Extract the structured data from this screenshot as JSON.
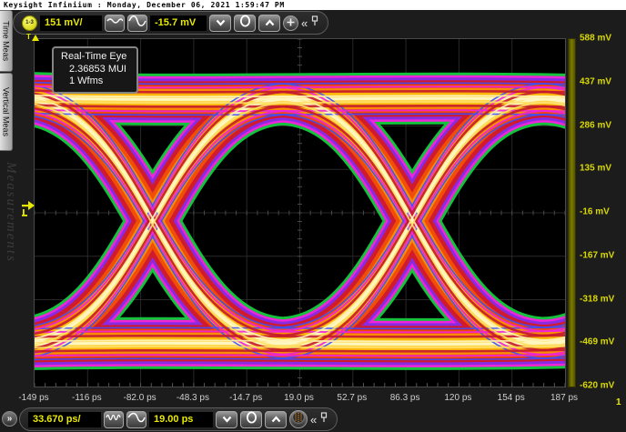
{
  "title_bar": {
    "text": "Keysight Infiniium : Monday, December 06, 2021 1:59:47 PM"
  },
  "sidebar": {
    "tabs": [
      {
        "label": "Time Meas"
      },
      {
        "label": "Vertical Meas"
      }
    ],
    "watermark": "Measurements"
  },
  "channel_toolbar": {
    "badge": "1-3",
    "scale": "151 mV/",
    "offset": "-15.7 mV"
  },
  "timebase_toolbar": {
    "scale": "33.670 ps/",
    "position": "19.00 ps"
  },
  "eye_overlay": {
    "title": "Real-Time Eye",
    "mui": "2.36853 MUI",
    "wfms": "1 Wfms"
  },
  "plot": {
    "trigger_marker": "T",
    "channel_indicator": "1",
    "y_ticks": [
      "588 mV",
      "437 mV",
      "286 mV",
      "135 mV",
      "-16 mV",
      "-167 mV",
      "-318 mV",
      "-469 mV",
      "-620 mV"
    ],
    "x_ticks": [
      "-149 ps",
      "-116 ps",
      "-82.0 ps",
      "-48.3 ps",
      "-14.7 ps",
      "19.0 ps",
      "52.7 ps",
      "86.3 ps",
      "120 ps",
      "154 ps",
      "187 ps"
    ]
  },
  "icons": {
    "collapse": "«",
    "expand": "»"
  },
  "colors": {
    "accent_yellow": "#e8e800",
    "y_label_yellow": "#d9d900",
    "x_label_gray": "#cfcfcf",
    "heat_core": "#fb8c03",
    "fringe_green": "#15c23c",
    "fringe_magenta": "#f024d8"
  }
}
